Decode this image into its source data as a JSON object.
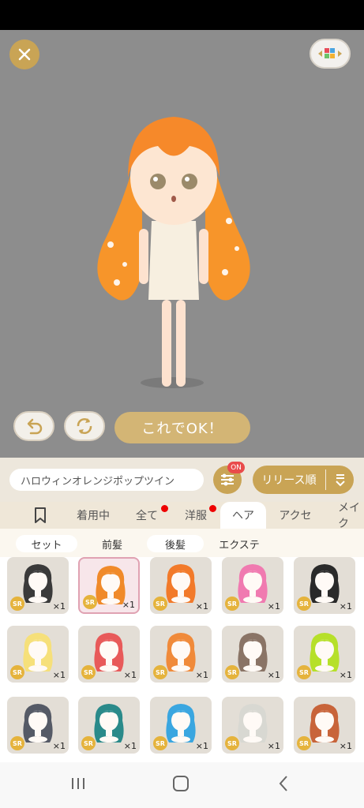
{
  "stage": {
    "ok_label": "これでOK！"
  },
  "filter": {
    "name": "ハロウィンオレンジポップツイン",
    "badge": "ON",
    "sort_label": "リリース順"
  },
  "tabs": [
    {
      "label": "",
      "icon": "bookmark-icon"
    },
    {
      "label": "着用中"
    },
    {
      "label": "全て",
      "dot": true
    },
    {
      "label": "洋服",
      "dot": true
    },
    {
      "label": "ヘア",
      "active": true
    },
    {
      "label": "アクセ"
    },
    {
      "label": "メイク"
    }
  ],
  "subtabs": [
    "セット",
    "前髪",
    "後髪",
    "エクステ"
  ],
  "items": [
    {
      "rarity": "SR",
      "qty": "×1",
      "hair": "#3a3a3a"
    },
    {
      "rarity": "SR",
      "qty": "×1",
      "hair": "#f08a2a",
      "selected": true
    },
    {
      "rarity": "SR",
      "qty": "×1",
      "hair": "#f27a2a"
    },
    {
      "rarity": "SR",
      "qty": "×1",
      "hair": "#f07ab0"
    },
    {
      "rarity": "SR",
      "qty": "×1",
      "hair": "#2a2a2a"
    },
    {
      "rarity": "SR",
      "qty": "×1",
      "hair": "#f6e07a"
    },
    {
      "rarity": "SR",
      "qty": "×1",
      "hair": "#e85a5a"
    },
    {
      "rarity": "SR",
      "qty": "×1",
      "hair": "#f08a3a"
    },
    {
      "rarity": "SR",
      "qty": "×1",
      "hair": "#8a7466"
    },
    {
      "rarity": "SR",
      "qty": "×1",
      "hair": "#b6e02a"
    },
    {
      "rarity": "SR",
      "qty": "×1",
      "hair": "#555a66"
    },
    {
      "rarity": "SR",
      "qty": "×1",
      "hair": "#2a8a8a"
    },
    {
      "rarity": "SR",
      "qty": "×1",
      "hair": "#3aa6e0"
    },
    {
      "rarity": "SR",
      "qty": "×1",
      "hair": "#d8d8d2"
    },
    {
      "rarity": "SR",
      "qty": "×1",
      "hair": "#c8643a"
    }
  ]
}
